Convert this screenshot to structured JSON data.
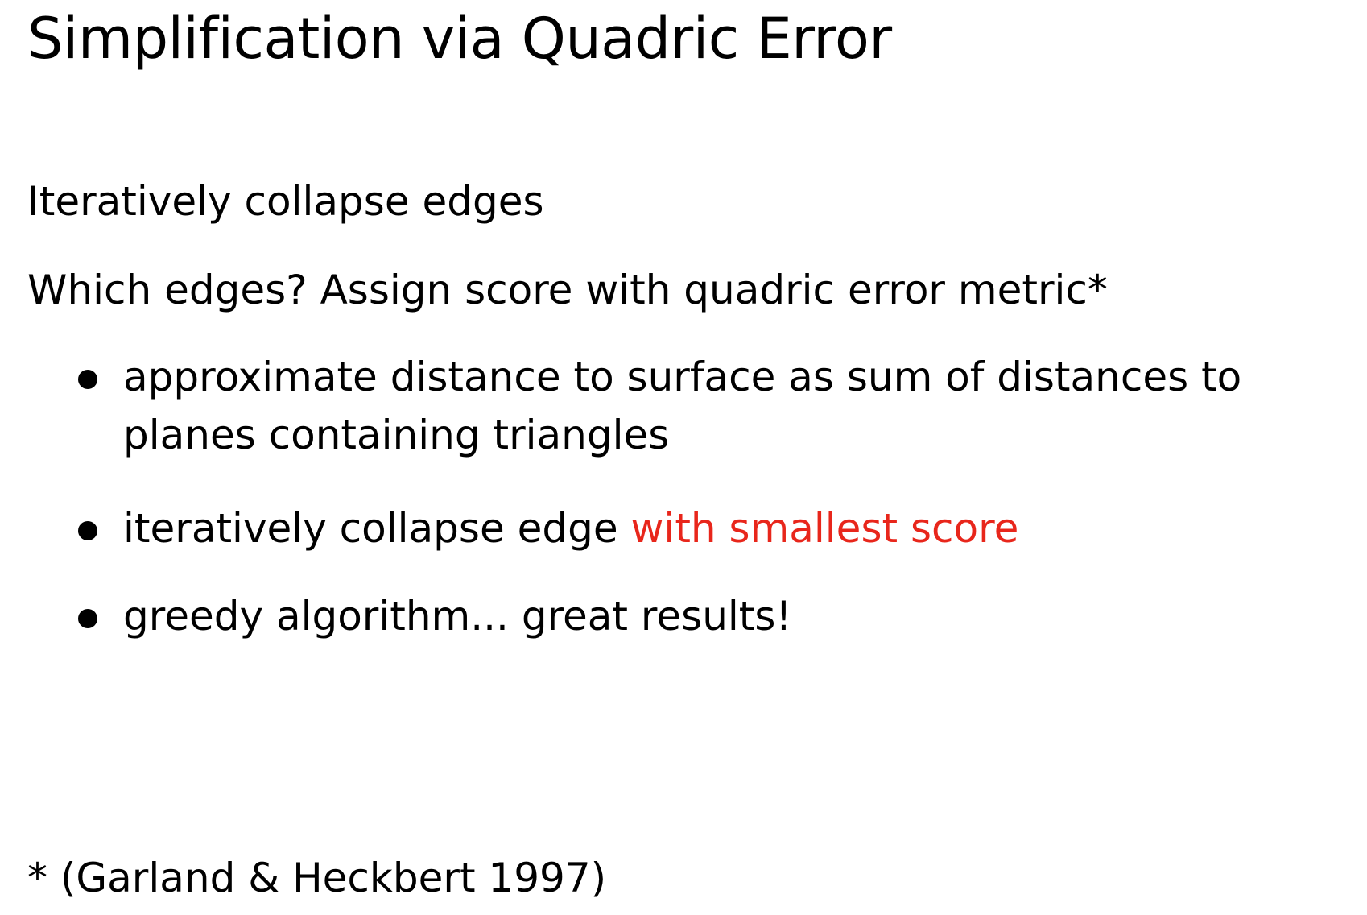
{
  "slide": {
    "title": "Simplification via Quadric Error",
    "lines": [
      "Iteratively collapse edges",
      "Which edges?  Assign score with quadric error metric*"
    ],
    "bullets": [
      {
        "line1": "approximate distance to surface as sum of distances to",
        "line2": "planes containing triangles"
      },
      {
        "text": "iteratively collapse edge",
        "highlight": "with smallest score"
      },
      {
        "text": "greedy algorithm... great results!"
      }
    ],
    "footnote": "* (Garland & Heckbert 1997)"
  },
  "colors": {
    "text": "#000000",
    "accent": "#e8261b",
    "background": "#ffffff"
  }
}
